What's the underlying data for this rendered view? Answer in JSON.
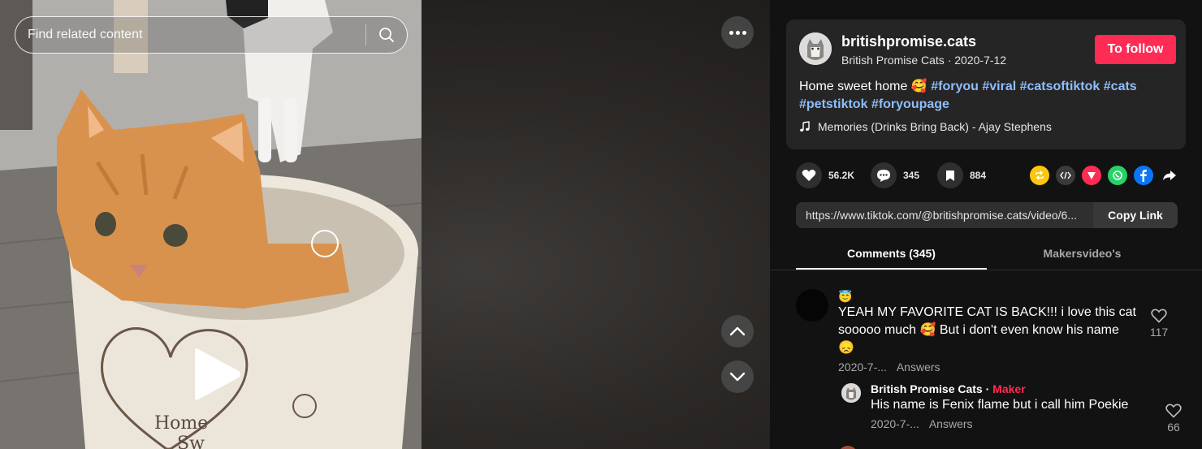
{
  "search": {
    "placeholder": "Find related content"
  },
  "video": {
    "more_label": "More",
    "nav_up_label": "Previous video",
    "nav_down_label": "Next video",
    "poster_text": [
      "Home",
      "Sw"
    ]
  },
  "post": {
    "username": "britishpromise.cats",
    "nickname": "British Promise Cats",
    "separator": "·",
    "date": "2020-7-12",
    "follow_label": "To follow",
    "caption_text": "Home sweet home 🥰",
    "hashtags": [
      "#foryou",
      "#viral",
      "#catsoftiktok",
      "#cats",
      "#petstiktok",
      "#foryoupage"
    ],
    "music": "Memories (Drinks Bring Back) - Ajay Stephens"
  },
  "actions": {
    "likes": "56.2K",
    "comments": "345",
    "saves": "884",
    "share_icons": [
      "repost-icon",
      "embed-icon",
      "send-icon",
      "whatsapp-icon",
      "facebook-icon",
      "share-arrow-icon"
    ]
  },
  "link": {
    "url": "https://www.tiktok.com/@britishpromise.cats/video/6...",
    "copy_label": "Copy Link"
  },
  "tabs": {
    "comments": "Comments (345)",
    "creator_videos": "Makersvideo's"
  },
  "comments": [
    {
      "name": "😇",
      "text": "YEAH MY FAVORITE CAT IS BACK!!! i love this cat sooooo much 🥰 But i don't even know his name 😞",
      "date": "2020-7-...",
      "answers_label": "Answers",
      "likes": "117"
    }
  ],
  "reply": {
    "name": "British Promise Cats",
    "separator": "·",
    "badge": "Maker",
    "text": "His name is Fenix flame but i call him Poekie",
    "date": "2020-7-...",
    "answers_label": "Answers",
    "likes": "66"
  },
  "colors": {
    "accent": "#fe2c55",
    "hashtag": "#8fbefc",
    "panel_bg": "#121212",
    "card_bg": "#252525"
  }
}
